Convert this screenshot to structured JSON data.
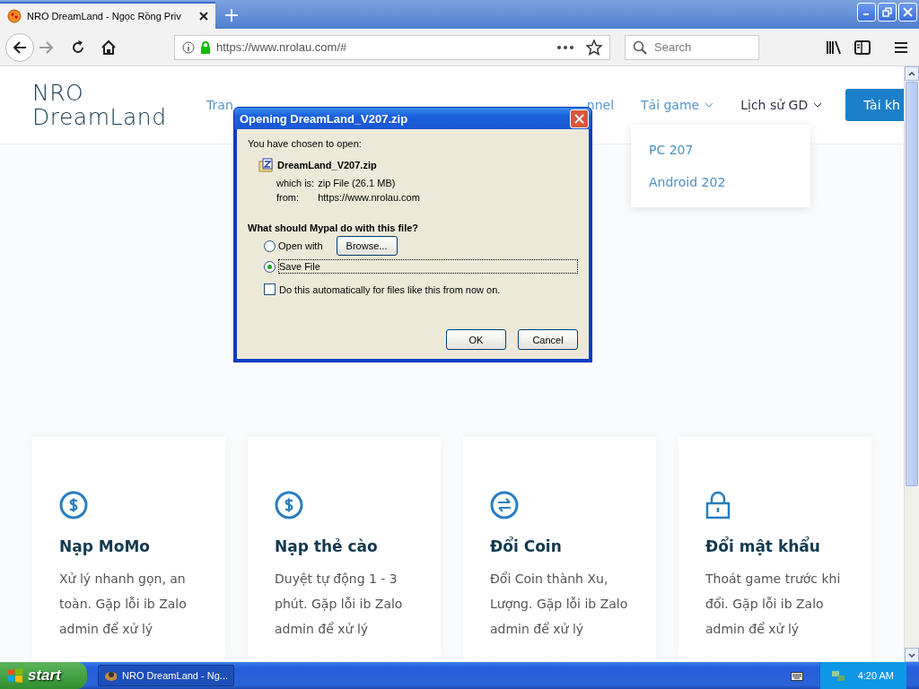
{
  "browser": {
    "tab_title": "NRO DreamLand - Ngọc Rồng Priv",
    "url": "https://www.nrolau.com/#",
    "search": {
      "placeholder": "Search"
    }
  },
  "site": {
    "logo": [
      "NRO",
      "DreamLand"
    ],
    "nav": [
      {
        "label": "Tran",
        "kind": "link"
      },
      {
        "label": "nnel",
        "kind": "link"
      },
      {
        "label": "Tải game",
        "kind": "dropdown",
        "expanded": true
      },
      {
        "label": "Lịch sử GD",
        "kind": "dropdown",
        "expanded": false
      }
    ],
    "dropdown_items": [
      "PC 207",
      "Android 202"
    ],
    "account_button": "Tài kh",
    "cards": [
      {
        "kind": "dollar",
        "title": "Nạp MoMo",
        "text": "Xử lý nhanh gọn, an toàn. Gặp lỗi ib Zalo admin để xử lý"
      },
      {
        "kind": "dollar",
        "title": "Nạp thẻ cào",
        "text": "Duyệt tự động 1 - 3 phút. Gặp lỗi ib Zalo admin để xử lý"
      },
      {
        "kind": "exchange",
        "title": "Đổi Coin",
        "text": "Đổi Coin thành Xu, Lượng. Gặp lỗi ib Zalo admin để xử lý"
      },
      {
        "kind": "lock",
        "title": "Đổi mật khẩu",
        "text": "Thoát game trước khi đổi. Gặp lỗi ib Zalo admin để xử lý"
      }
    ]
  },
  "dialog": {
    "title": "Opening DreamLand_V207.zip",
    "intro": "You have chosen to open:",
    "file_name": "DreamLand_V207.zip",
    "details": [
      {
        "label": "which is:",
        "value": "zip File (26.1 MB)"
      },
      {
        "label": "from:",
        "value": "https://www.nrolau.com"
      }
    ],
    "question": "What should Mypal do with this file?",
    "options": [
      {
        "label": "Open with",
        "selected": false,
        "button": "Browse..."
      },
      {
        "label": "Save File",
        "selected": true
      }
    ],
    "auto_checkbox": {
      "label": "Do this automatically for files like this from now on.",
      "checked": false
    },
    "buttons": [
      "OK",
      "Cancel"
    ]
  },
  "taskbar": {
    "start": "start",
    "tasks": [
      "NRO DreamLand - Ng..."
    ],
    "clock": "4:20 AM"
  }
}
